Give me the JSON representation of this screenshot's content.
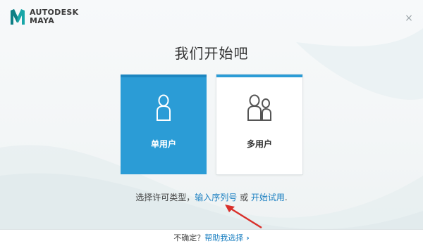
{
  "header": {
    "brand_line1": "AUTODESK",
    "brand_line2": "MAYA",
    "close_glyph": "×"
  },
  "main": {
    "title": "我们开始吧",
    "cards": [
      {
        "label": "单用户",
        "icon": "single-user-icon"
      },
      {
        "label": "多用户",
        "icon": "multi-user-icon"
      }
    ],
    "prompt_text": "选择许可类型，",
    "serial_link": "输入序列号",
    "or_text": " 或 ",
    "trial_link": "开始试用",
    "period": "."
  },
  "footer": {
    "unsure_text": "不确定？",
    "help_link": "帮助我选择",
    "chevron": "›"
  },
  "colors": {
    "accent": "#2b9cd6",
    "link": "#1a7fc1",
    "annotation_arrow": "#d9302b"
  }
}
